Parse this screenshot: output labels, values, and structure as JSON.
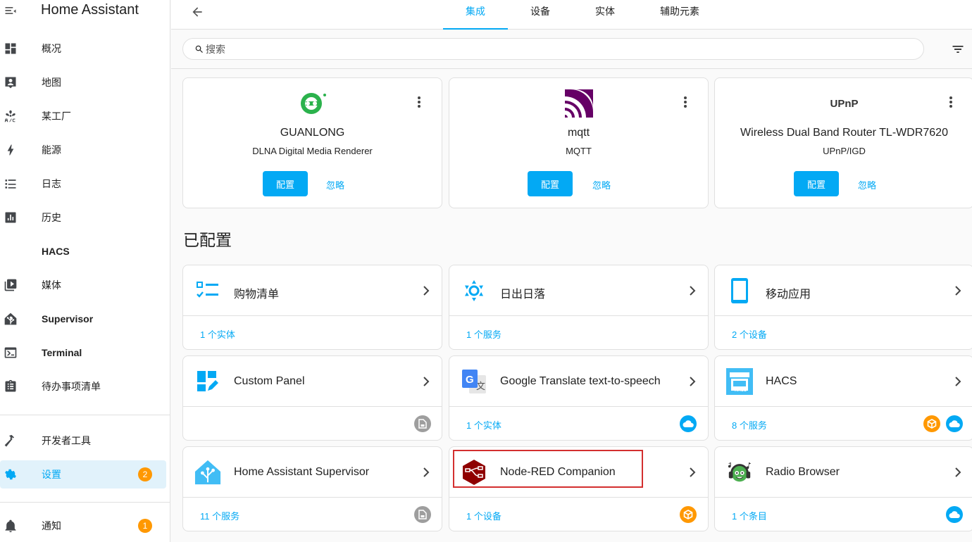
{
  "app": {
    "title": "Home Assistant"
  },
  "sidebar": {
    "items": [
      {
        "label": "概况",
        "icon": "dashboard-icon"
      },
      {
        "label": "地图",
        "icon": "map-account-icon"
      },
      {
        "label": "某工厂",
        "icon": "air-conditioner-icon"
      },
      {
        "label": "能源",
        "icon": "lightning-bolt-icon"
      },
      {
        "label": "日志",
        "icon": "format-list-bulleted-icon"
      },
      {
        "label": "历史",
        "icon": "chart-box-icon"
      },
      {
        "label": "HACS",
        "icon": ""
      },
      {
        "label": "媒体",
        "icon": "play-box-multiple-icon"
      },
      {
        "label": "Supervisor",
        "icon": "home-assistant-icon"
      },
      {
        "label": "Terminal",
        "icon": "console-icon"
      },
      {
        "label": "待办事项清单",
        "icon": "clipboard-list-icon"
      }
    ],
    "dev_tools": {
      "label": "开发者工具",
      "icon": "hammer-icon"
    },
    "settings": {
      "label": "设置",
      "badge": "2",
      "icon": "cog-icon"
    },
    "notifications": {
      "label": "通知",
      "badge": "1",
      "icon": "bell-icon"
    }
  },
  "tabs": [
    "集成",
    "设备",
    "实体",
    "辅助元素"
  ],
  "search": {
    "placeholder": "搜索"
  },
  "discovered": [
    {
      "name": "GUANLONG",
      "sub": "DLNA Digital Media Renderer",
      "configure": "配置",
      "ignore": "忽略",
      "logo": "dlna-logo"
    },
    {
      "name": "mqtt",
      "sub": "MQTT",
      "configure": "配置",
      "ignore": "忽略",
      "logo": "mqtt-logo"
    },
    {
      "name": "Wireless Dual Band Router TL-WDR7620",
      "sub": "UPnP/IGD",
      "configure": "配置",
      "ignore": "忽略",
      "logo": "upnp-logo",
      "logo_text": "UPnP"
    }
  ],
  "configured_title": "已配置",
  "configured": [
    {
      "title": "购物清单",
      "foot": "1 个实体",
      "icon": "shopping-list-icon",
      "badges": []
    },
    {
      "title": "日出日落",
      "foot": "1 个服务",
      "icon": "sun-icon",
      "badges": []
    },
    {
      "title": "移动应用",
      "foot": "2 个设备",
      "icon": "cellphone-icon",
      "badges": []
    },
    {
      "title": "Custom Panel",
      "foot": "",
      "icon": "custom-panel-icon",
      "badges": [
        "local"
      ]
    },
    {
      "title": "Google Translate text-to-speech",
      "foot": "1 个实体",
      "icon": "google-translate-icon",
      "badges": [
        "cloud"
      ]
    },
    {
      "title": "HACS",
      "foot": "8 个服务",
      "icon": "hacs-icon",
      "logo_text": "HACS",
      "badges": [
        "custom",
        "cloud"
      ]
    },
    {
      "title": "Home Assistant Supervisor",
      "foot": "11 个服务",
      "icon": "home-assistant-icon",
      "badges": [
        "local"
      ]
    },
    {
      "title": "Node-RED Companion",
      "foot": "1 个设备",
      "icon": "node-red-icon",
      "badges": [
        "custom"
      ]
    },
    {
      "title": "Radio Browser",
      "foot": "1 个条目",
      "icon": "radio-browser-icon",
      "badges": [
        "cloud"
      ]
    }
  ],
  "colors": {
    "accent": "#03a9f4",
    "badge": "#ff9800",
    "highlight": "#d32f2f"
  }
}
